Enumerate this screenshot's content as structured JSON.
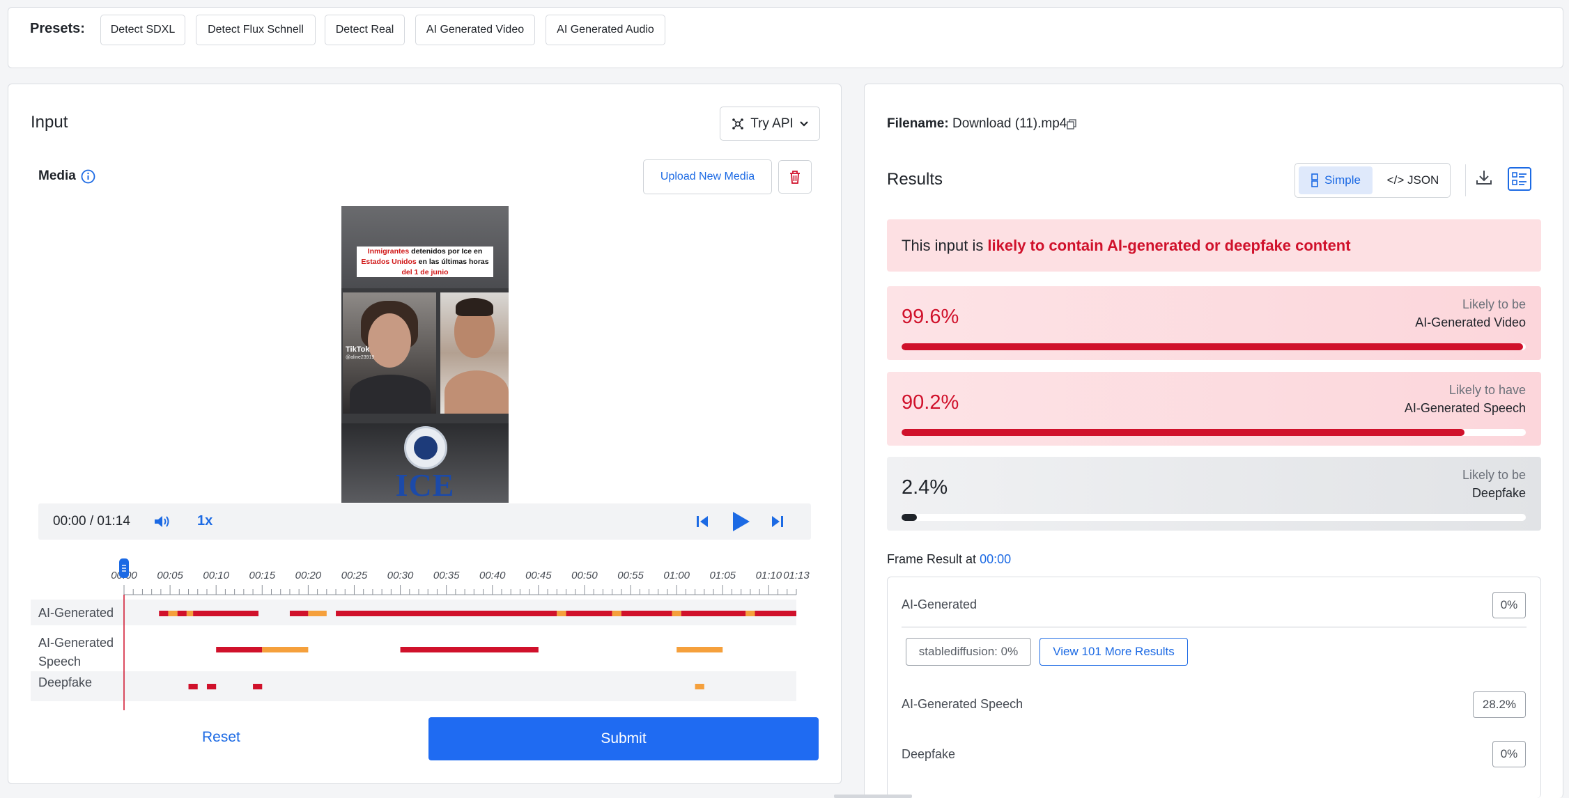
{
  "presets": {
    "label": "Presets:",
    "items": [
      "Detect SDXL",
      "Detect Flux Schnell",
      "Detect Real",
      "AI Generated Video",
      "AI Generated Audio"
    ]
  },
  "input": {
    "title": "Input",
    "try_api": "Try API",
    "media_label": "Media",
    "upload_button": "Upload New Media",
    "video": {
      "caption_red1": "Inmigrantes",
      "caption_black1": " detenidos por Ice en ",
      "caption_red2": "Estados Unidos",
      "caption_black2": " en las últimas horas ",
      "caption_red3": "del 1 de junio",
      "tiktok": "TikTok",
      "handle": "@aline23919",
      "ice_text": "ICE"
    },
    "player": {
      "time": "00:00 / 01:14",
      "speed": "1x"
    },
    "timeline": {
      "ticks": [
        "00:00",
        "00:05",
        "00:10",
        "00:15",
        "00:20",
        "00:25",
        "00:30",
        "00:35",
        "00:40",
        "00:45",
        "00:50",
        "00:55",
        "01:00",
        "01:05",
        "01:10",
        "01:13"
      ],
      "tracks": [
        "AI-Generated",
        "AI-Generated\nSpeech",
        "Deepfake"
      ]
    },
    "reset": "Reset",
    "submit": "Submit"
  },
  "results": {
    "filename_label": "Filename:",
    "filename": "Download (11).mp4",
    "title": "Results",
    "view_simple": "Simple",
    "view_json": "</> JSON",
    "verdict_prefix": "This input is",
    "verdict_highlight": "likely to contain AI-generated or deepfake content",
    "scores": [
      {
        "pct": "99.6%",
        "value": 0.996,
        "line1": "Likely to be",
        "line2": "AI-Generated Video",
        "tone": "red"
      },
      {
        "pct": "90.2%",
        "value": 0.902,
        "line1": "Likely to have",
        "line2": "AI-Generated Speech",
        "tone": "red"
      },
      {
        "pct": "2.4%",
        "value": 0.024,
        "line1": "Likely to be",
        "line2": "Deepfake",
        "tone": "gray"
      }
    ],
    "frame_label": "Frame Result at",
    "frame_time": "00:00",
    "frame": {
      "ai_generated_label": "AI-Generated",
      "ai_generated_value": "0%",
      "chip_model": "stablediffusion: 0%",
      "chip_more": "View 101 More Results",
      "speech_label": "AI-Generated Speech",
      "speech_value": "28.2%",
      "deepfake_label": "Deepfake",
      "deepfake_value": "0%"
    }
  },
  "colors": {
    "accent": "#1c6ae4",
    "submit": "#1f6bf2",
    "alert_red": "#d0112b",
    "segment_red": "#d0112b",
    "segment_orange": "#f5a03c"
  },
  "icons": [
    "info-icon",
    "try-api-icon",
    "chevron-down-icon",
    "trash-icon",
    "volume-icon",
    "skip-back-icon",
    "play-icon",
    "skip-forward-icon",
    "copy-icon",
    "simple-view-icon",
    "download-icon",
    "list-view-icon",
    "playhead-icon"
  ]
}
